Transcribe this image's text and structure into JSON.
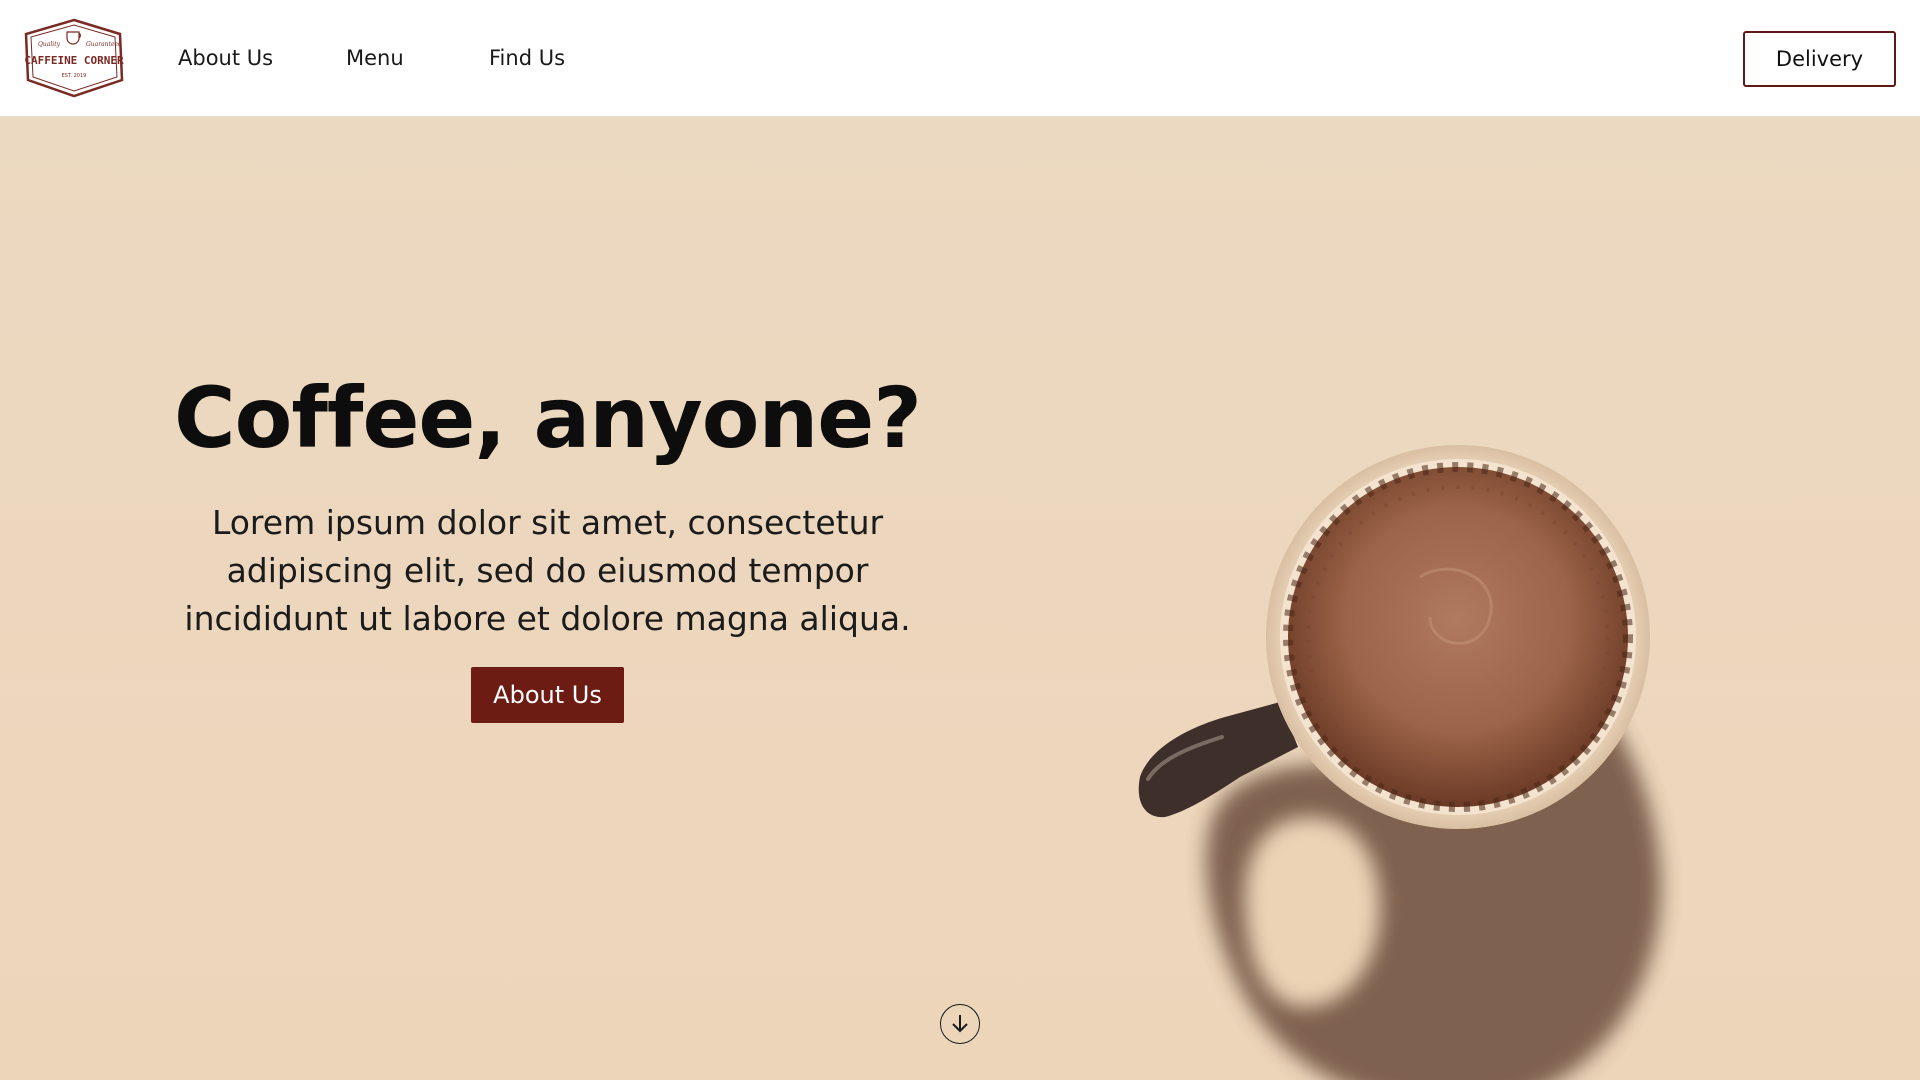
{
  "brand": {
    "logo_text": "CAFFEINE CORNER",
    "logo_tagline_left": "Quality",
    "logo_tagline_right": "Guaranteed",
    "logo_est": "EST. 2019",
    "accent_color": "#6d1c14"
  },
  "nav": {
    "items": [
      {
        "label": "About Us"
      },
      {
        "label": "Menu"
      },
      {
        "label": "Find Us"
      }
    ],
    "delivery_label": "Delivery"
  },
  "hero": {
    "title": "Coffee, anyone?",
    "text": "Lorem ipsum dolor sit amet, consectetur adipiscing elit, sed do eiusmod tempor incididunt ut labore et dolore magna aliqua.",
    "button_label": "About Us",
    "background_color": "#ecd8c0",
    "image_icon": "coffee-cup-icon",
    "scroll_icon": "arrow-down-circle-icon"
  }
}
